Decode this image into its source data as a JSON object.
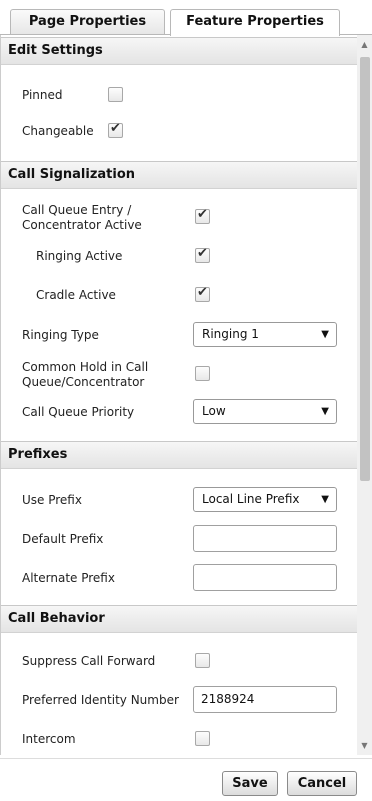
{
  "tabs": [
    {
      "label": "Page Properties",
      "active": false
    },
    {
      "label": "Feature Properties",
      "active": true
    }
  ],
  "sections": {
    "edit_settings": {
      "title": "Edit Settings",
      "pinned": {
        "label": "Pinned",
        "checked": false
      },
      "changeable": {
        "label": "Changeable",
        "checked": true
      }
    },
    "call_signalization": {
      "title": "Call Signalization",
      "call_queue_entry": {
        "label_line1": "Call Queue Entry /",
        "label_line2": "Concentrator Active",
        "checked": true
      },
      "ringing_active": {
        "label": "Ringing Active",
        "checked": true
      },
      "cradle_active": {
        "label": "Cradle Active",
        "checked": true
      },
      "ringing_type": {
        "label": "Ringing Type",
        "value": "Ringing 1"
      },
      "common_hold": {
        "label_line1": "Common Hold in Call",
        "label_line2": "Queue/Concentrator",
        "checked": false
      },
      "queue_priority": {
        "label": "Call Queue Priority",
        "value": "Low"
      }
    },
    "prefixes": {
      "title": "Prefixes",
      "use_prefix": {
        "label": "Use Prefix",
        "value": "Local Line Prefix"
      },
      "default_prefix": {
        "label": "Default Prefix",
        "value": ""
      },
      "alternate_prefix": {
        "label": "Alternate Prefix",
        "value": ""
      }
    },
    "call_behavior": {
      "title": "Call Behavior",
      "suppress_call_forward": {
        "label": "Suppress Call Forward",
        "checked": false
      },
      "preferred_identity": {
        "label": "Preferred Identity Number",
        "value": "2188924"
      },
      "intercom": {
        "label": "Intercom",
        "checked": false
      }
    }
  },
  "icons": {
    "dropdown": "triangle-down-icon",
    "checkmark": "checkmark-icon"
  },
  "footer": {
    "save_label": "Save",
    "cancel_label": "Cancel"
  }
}
